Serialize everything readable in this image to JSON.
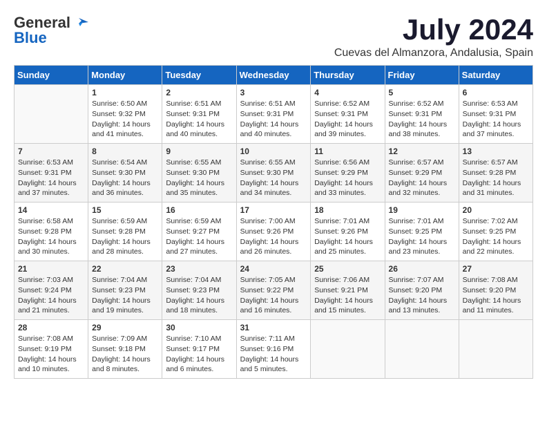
{
  "logo": {
    "general": "General",
    "blue": "Blue"
  },
  "title": {
    "month": "July 2024",
    "location": "Cuevas del Almanzora, Andalusia, Spain"
  },
  "headers": [
    "Sunday",
    "Monday",
    "Tuesday",
    "Wednesday",
    "Thursday",
    "Friday",
    "Saturday"
  ],
  "weeks": [
    [
      {
        "day": "",
        "content": ""
      },
      {
        "day": "1",
        "content": "Sunrise: 6:50 AM\nSunset: 9:32 PM\nDaylight: 14 hours\nand 41 minutes."
      },
      {
        "day": "2",
        "content": "Sunrise: 6:51 AM\nSunset: 9:31 PM\nDaylight: 14 hours\nand 40 minutes."
      },
      {
        "day": "3",
        "content": "Sunrise: 6:51 AM\nSunset: 9:31 PM\nDaylight: 14 hours\nand 40 minutes."
      },
      {
        "day": "4",
        "content": "Sunrise: 6:52 AM\nSunset: 9:31 PM\nDaylight: 14 hours\nand 39 minutes."
      },
      {
        "day": "5",
        "content": "Sunrise: 6:52 AM\nSunset: 9:31 PM\nDaylight: 14 hours\nand 38 minutes."
      },
      {
        "day": "6",
        "content": "Sunrise: 6:53 AM\nSunset: 9:31 PM\nDaylight: 14 hours\nand 37 minutes."
      }
    ],
    [
      {
        "day": "7",
        "content": "Sunrise: 6:53 AM\nSunset: 9:31 PM\nDaylight: 14 hours\nand 37 minutes."
      },
      {
        "day": "8",
        "content": "Sunrise: 6:54 AM\nSunset: 9:30 PM\nDaylight: 14 hours\nand 36 minutes."
      },
      {
        "day": "9",
        "content": "Sunrise: 6:55 AM\nSunset: 9:30 PM\nDaylight: 14 hours\nand 35 minutes."
      },
      {
        "day": "10",
        "content": "Sunrise: 6:55 AM\nSunset: 9:30 PM\nDaylight: 14 hours\nand 34 minutes."
      },
      {
        "day": "11",
        "content": "Sunrise: 6:56 AM\nSunset: 9:29 PM\nDaylight: 14 hours\nand 33 minutes."
      },
      {
        "day": "12",
        "content": "Sunrise: 6:57 AM\nSunset: 9:29 PM\nDaylight: 14 hours\nand 32 minutes."
      },
      {
        "day": "13",
        "content": "Sunrise: 6:57 AM\nSunset: 9:28 PM\nDaylight: 14 hours\nand 31 minutes."
      }
    ],
    [
      {
        "day": "14",
        "content": "Sunrise: 6:58 AM\nSunset: 9:28 PM\nDaylight: 14 hours\nand 30 minutes."
      },
      {
        "day": "15",
        "content": "Sunrise: 6:59 AM\nSunset: 9:28 PM\nDaylight: 14 hours\nand 28 minutes."
      },
      {
        "day": "16",
        "content": "Sunrise: 6:59 AM\nSunset: 9:27 PM\nDaylight: 14 hours\nand 27 minutes."
      },
      {
        "day": "17",
        "content": "Sunrise: 7:00 AM\nSunset: 9:26 PM\nDaylight: 14 hours\nand 26 minutes."
      },
      {
        "day": "18",
        "content": "Sunrise: 7:01 AM\nSunset: 9:26 PM\nDaylight: 14 hours\nand 25 minutes."
      },
      {
        "day": "19",
        "content": "Sunrise: 7:01 AM\nSunset: 9:25 PM\nDaylight: 14 hours\nand 23 minutes."
      },
      {
        "day": "20",
        "content": "Sunrise: 7:02 AM\nSunset: 9:25 PM\nDaylight: 14 hours\nand 22 minutes."
      }
    ],
    [
      {
        "day": "21",
        "content": "Sunrise: 7:03 AM\nSunset: 9:24 PM\nDaylight: 14 hours\nand 21 minutes."
      },
      {
        "day": "22",
        "content": "Sunrise: 7:04 AM\nSunset: 9:23 PM\nDaylight: 14 hours\nand 19 minutes."
      },
      {
        "day": "23",
        "content": "Sunrise: 7:04 AM\nSunset: 9:23 PM\nDaylight: 14 hours\nand 18 minutes."
      },
      {
        "day": "24",
        "content": "Sunrise: 7:05 AM\nSunset: 9:22 PM\nDaylight: 14 hours\nand 16 minutes."
      },
      {
        "day": "25",
        "content": "Sunrise: 7:06 AM\nSunset: 9:21 PM\nDaylight: 14 hours\nand 15 minutes."
      },
      {
        "day": "26",
        "content": "Sunrise: 7:07 AM\nSunset: 9:20 PM\nDaylight: 14 hours\nand 13 minutes."
      },
      {
        "day": "27",
        "content": "Sunrise: 7:08 AM\nSunset: 9:20 PM\nDaylight: 14 hours\nand 11 minutes."
      }
    ],
    [
      {
        "day": "28",
        "content": "Sunrise: 7:08 AM\nSunset: 9:19 PM\nDaylight: 14 hours\nand 10 minutes."
      },
      {
        "day": "29",
        "content": "Sunrise: 7:09 AM\nSunset: 9:18 PM\nDaylight: 14 hours\nand 8 minutes."
      },
      {
        "day": "30",
        "content": "Sunrise: 7:10 AM\nSunset: 9:17 PM\nDaylight: 14 hours\nand 6 minutes."
      },
      {
        "day": "31",
        "content": "Sunrise: 7:11 AM\nSunset: 9:16 PM\nDaylight: 14 hours\nand 5 minutes."
      },
      {
        "day": "",
        "content": ""
      },
      {
        "day": "",
        "content": ""
      },
      {
        "day": "",
        "content": ""
      }
    ]
  ]
}
